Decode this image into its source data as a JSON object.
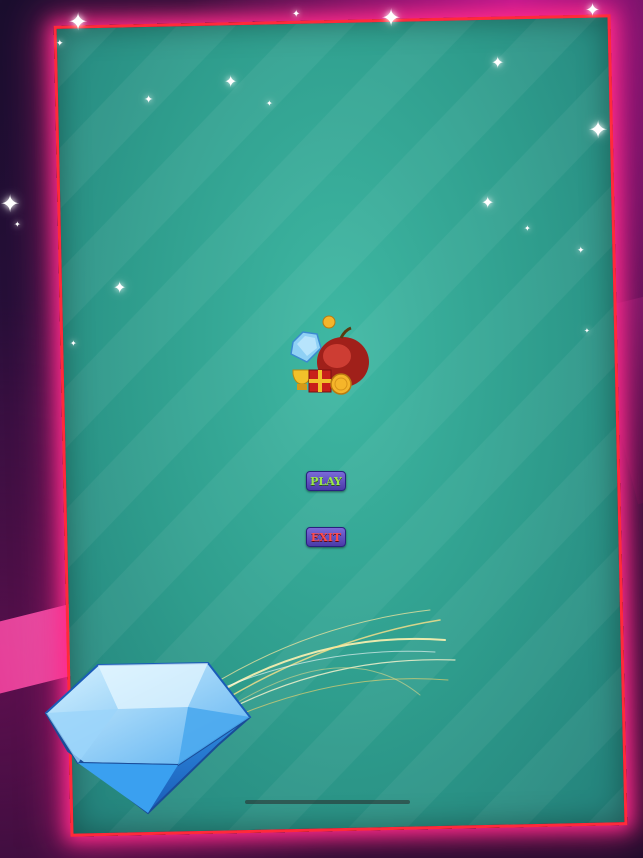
{
  "buttons": {
    "play_label": "PLAY",
    "exit_label": "EXIT"
  },
  "colors": {
    "frame_border": "#ff2a3a",
    "board": "#2e9c8c",
    "play_text": "#9be84a",
    "exit_text": "#ff4a4a",
    "button_fill": "#5a4ac0"
  },
  "icons": [
    "sparkle-star-icon",
    "treasure-logo",
    "diamond-gem-icon",
    "shooting-trail"
  ]
}
